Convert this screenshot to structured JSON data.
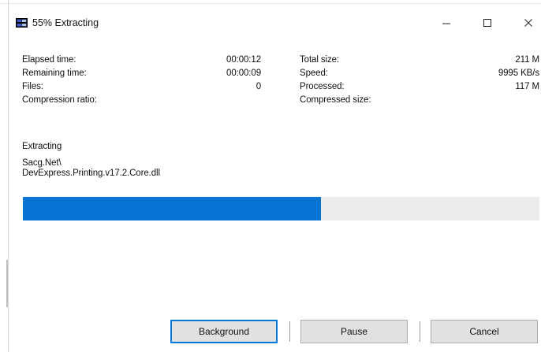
{
  "window": {
    "title": "55% Extracting",
    "icon": "winrar-archive-icon",
    "controls": {
      "minimize": "minimize-icon",
      "maximize": "maximize-icon",
      "close": "close-icon"
    }
  },
  "stats_left": [
    {
      "label": "Elapsed time:",
      "value": "00:00:12"
    },
    {
      "label": "Remaining time:",
      "value": "00:00:09"
    },
    {
      "label": "Files:",
      "value": "0"
    },
    {
      "label": "Compression ratio:",
      "value": ""
    }
  ],
  "stats_right": [
    {
      "label": "Total size:",
      "value": "211 M"
    },
    {
      "label": "Speed:",
      "value": "9995 KB/s"
    },
    {
      "label": "Processed:",
      "value": "117 M"
    },
    {
      "label": "Compressed size:",
      "value": ""
    }
  ],
  "status": {
    "action": "Extracting",
    "path_line1": "Sacg.Net\\",
    "path_line2": "DevExpress.Printing.v17.2.Core.dll"
  },
  "progress": {
    "percent": 55,
    "fill_color": "#0a74d4"
  },
  "buttons": {
    "background": "Background",
    "pause": "Pause",
    "cancel": "Cancel"
  }
}
